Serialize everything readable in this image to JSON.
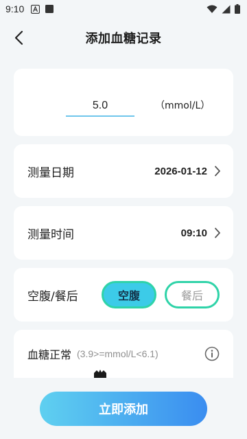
{
  "status_bar": {
    "time": "9:10"
  },
  "header": {
    "title": "添加血糖记录"
  },
  "value_card": {
    "value": "5.0",
    "unit": "（mmol/L）"
  },
  "date_row": {
    "label": "测量日期",
    "value": "2026-01-12"
  },
  "time_row": {
    "label": "测量时间",
    "value": "09:10"
  },
  "meal_row": {
    "label": "空腹/餐后",
    "options": [
      "空腹",
      "餐后"
    ],
    "selected": "空腹"
  },
  "status_row": {
    "title": "血糖正常",
    "range": "(3.9>=mmol/L<6.1)"
  },
  "footer": {
    "add_label": "立即添加"
  },
  "colors": {
    "accent_start": "#5fd0f0",
    "accent_end": "#3a8df0",
    "selected_fill": "#3ccbe8",
    "pill_border": "#2fd3a8"
  }
}
